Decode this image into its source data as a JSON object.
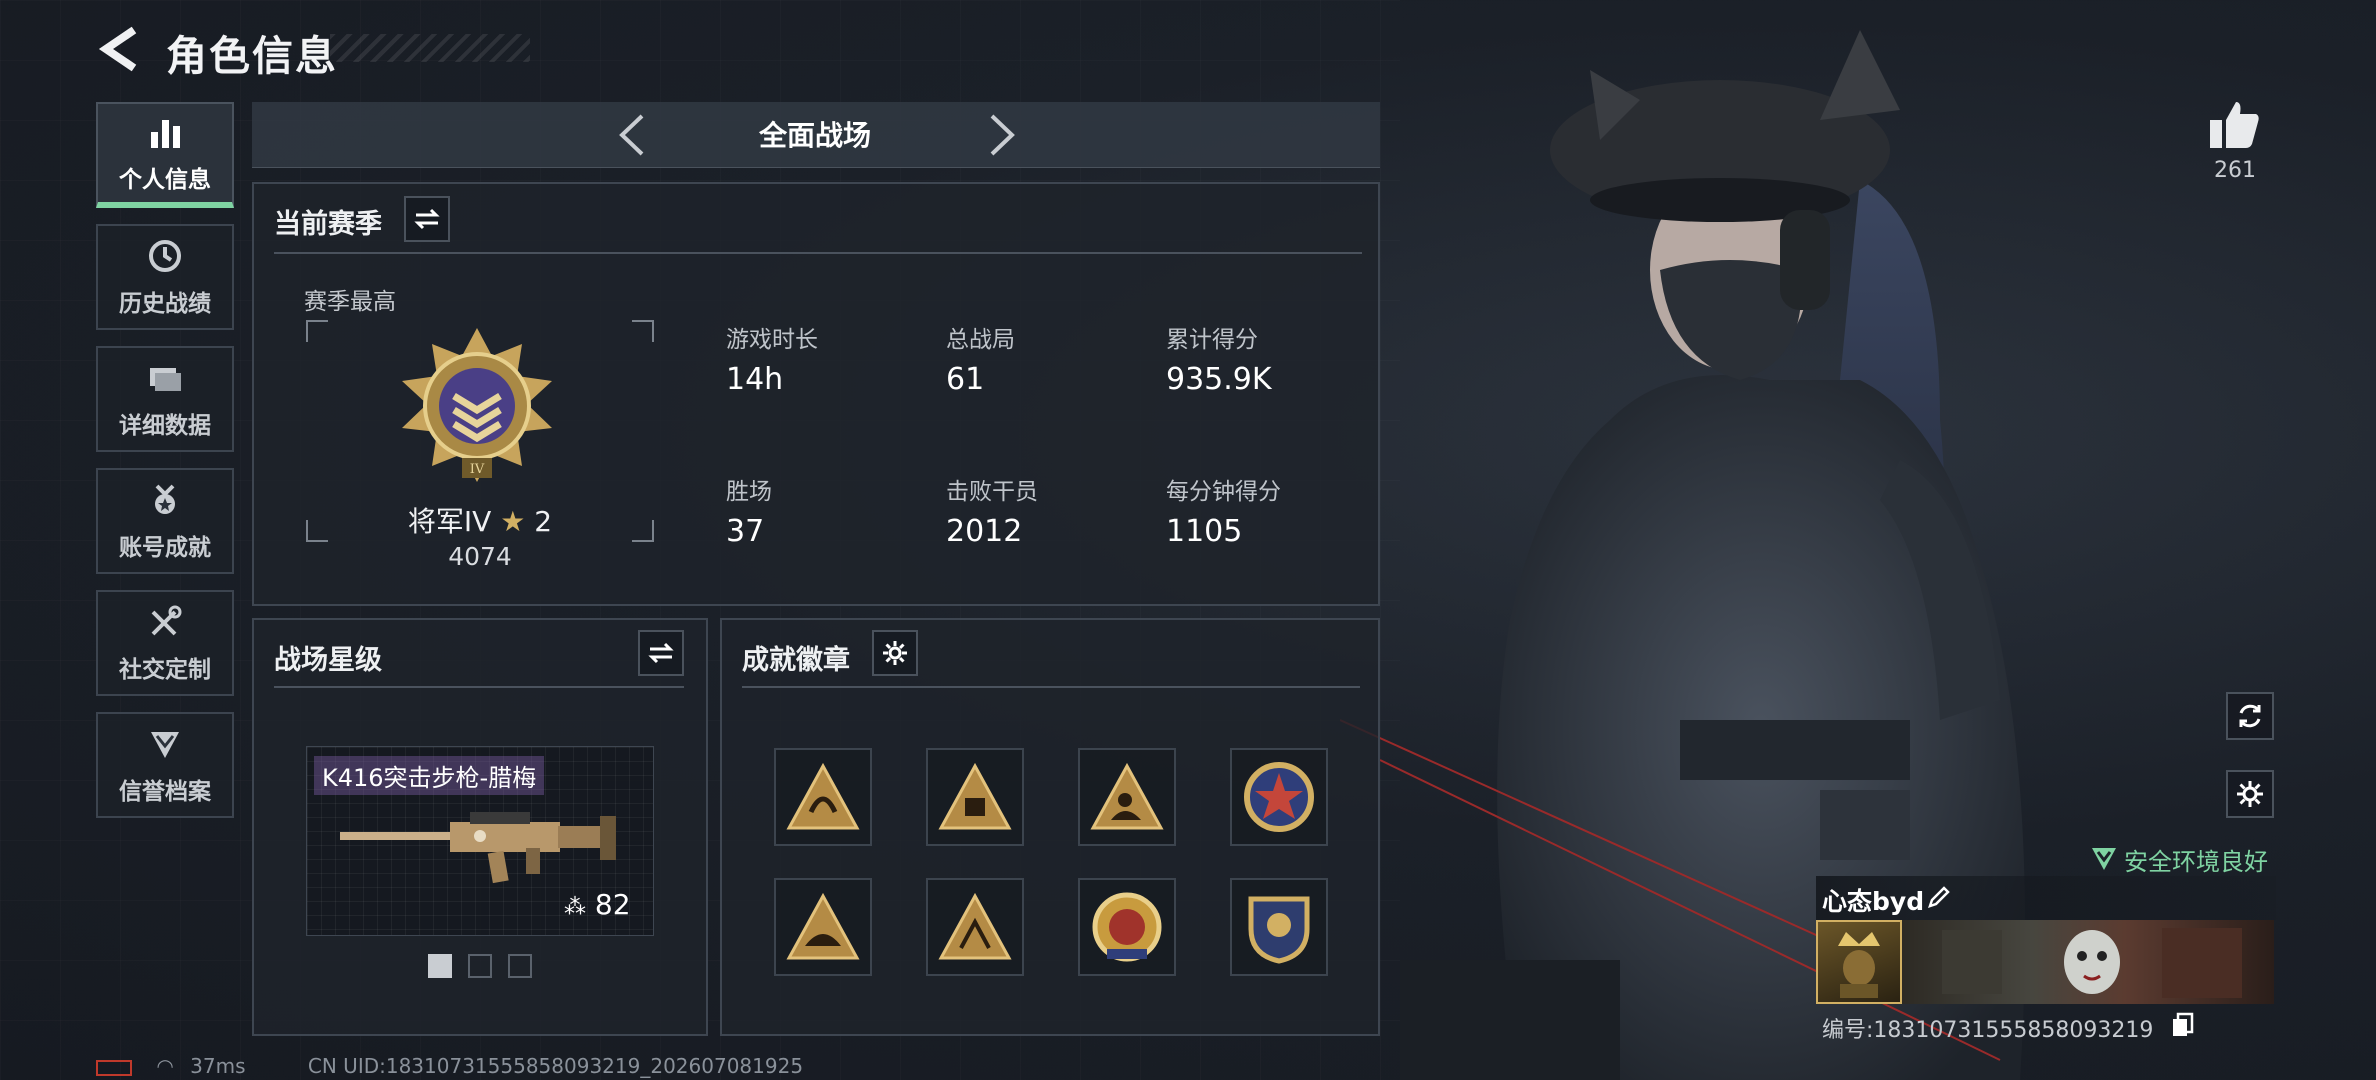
{
  "header": {
    "title": "角色信息"
  },
  "sidebar": {
    "items": [
      {
        "label": "个人信息",
        "icon": "bar-chart-icon",
        "active": true
      },
      {
        "label": "历史战绩",
        "icon": "clock-icon",
        "active": false
      },
      {
        "label": "详细数据",
        "icon": "folder-icon",
        "active": false
      },
      {
        "label": "账号成就",
        "icon": "medal-icon",
        "active": false
      },
      {
        "label": "社交定制",
        "icon": "tools-icon",
        "active": false
      },
      {
        "label": "信誉档案",
        "icon": "shield-chevron-icon",
        "active": false
      }
    ]
  },
  "mode": {
    "label": "全面战场"
  },
  "season": {
    "title": "当前赛季",
    "best_label": "赛季最高",
    "rank_name": "将军IV",
    "rank_stars": "2",
    "rank_score": "4074",
    "stats": [
      {
        "label": "游戏时长",
        "value": "14h"
      },
      {
        "label": "总战局",
        "value": "61"
      },
      {
        "label": "累计得分",
        "value": "935.9K"
      },
      {
        "label": "胜场",
        "value": "37"
      },
      {
        "label": "击败干员",
        "value": "2012"
      },
      {
        "label": "每分钟得分",
        "value": "1105"
      }
    ]
  },
  "star_level": {
    "title": "战场星级",
    "weapon_name": "K416突击步枪-腊梅",
    "weapon_level": "82"
  },
  "badges": {
    "title": "成就徽章",
    "items": [
      "badge-horn",
      "badge-triangle-gold",
      "badge-soldier",
      "badge-star-round",
      "badge-horn-2",
      "badge-pyramid",
      "badge-eagle-round",
      "badge-shield-round"
    ]
  },
  "right": {
    "like_count": "261",
    "env_status": "安全环境良好",
    "player_name": "心态byd",
    "player_id": "编号:18310731555858093219"
  },
  "footer": {
    "ping": "37ms",
    "uid": "CN UID:18310731555858093219_202607081925"
  },
  "colors": {
    "accent_green": "#7fd3a2",
    "gold": "#d2b063"
  }
}
